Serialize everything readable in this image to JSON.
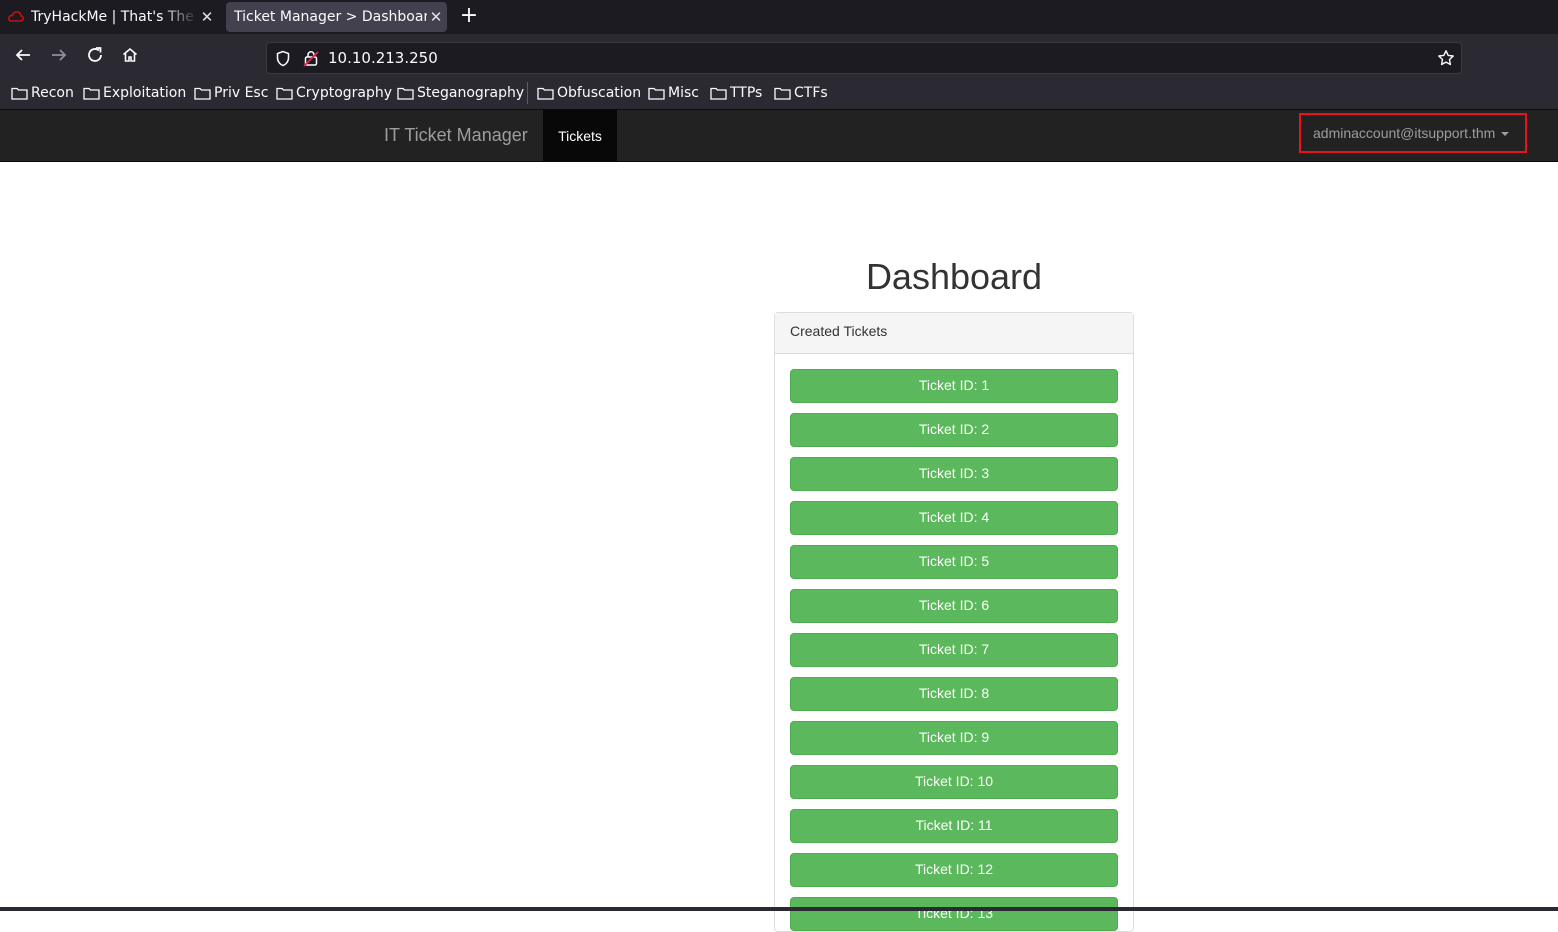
{
  "browser": {
    "tabs": [
      {
        "title": "TryHackMe | That's The Ticket"
      },
      {
        "title": "Ticket Manager > Dashboard"
      }
    ],
    "url": "10.10.213.250",
    "bookmarks": [
      "Recon",
      "Exploitation",
      "Priv Esc",
      "Cryptography",
      "Steganography",
      "Obfuscation",
      "Misc",
      "TTPs",
      "CTFs"
    ]
  },
  "site": {
    "brand": "IT Ticket Manager",
    "nav_tickets": "Tickets",
    "user": "adminaccount@itsupport.thm"
  },
  "dashboard": {
    "title": "Dashboard",
    "panel_heading": "Created Tickets",
    "tickets": [
      "Ticket ID: 1",
      "Ticket ID: 2",
      "Ticket ID: 3",
      "Ticket ID: 4",
      "Ticket ID: 5",
      "Ticket ID: 6",
      "Ticket ID: 7",
      "Ticket ID: 8",
      "Ticket ID: 9",
      "Ticket ID: 10",
      "Ticket ID: 11",
      "Ticket ID: 12",
      "Ticket ID: 13"
    ]
  },
  "colors": {
    "ticket_button": "#5cb85c",
    "highlight": "#e8141b",
    "navbar": "#222222"
  }
}
